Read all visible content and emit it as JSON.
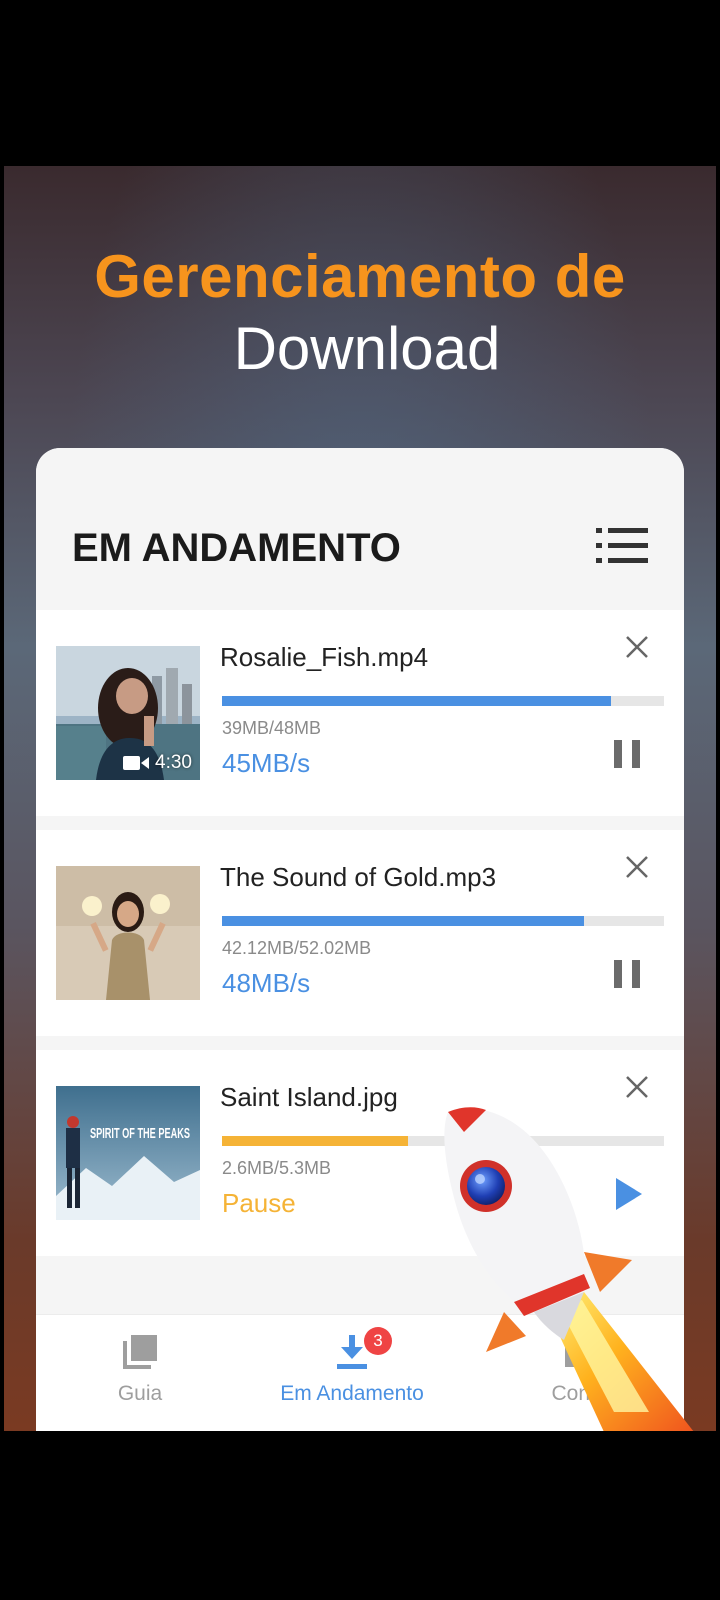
{
  "promo": {
    "headline": "Gerenciamento de",
    "subline": "Download"
  },
  "panel": {
    "title": "EM ANDAMENTO",
    "menu_icon": "list-icon"
  },
  "downloads": [
    {
      "filename": "Rosalie_Fish.mp4",
      "size": "39MB/48MB",
      "status": "45MB/s",
      "duration": "4:30",
      "progress": 0.88,
      "state": "downloading",
      "bar_color": "#4a90e2",
      "status_color": "#4a90e2"
    },
    {
      "filename": "The Sound of Gold.mp3",
      "size": "42.12MB/52.02MB",
      "status": "48MB/s",
      "progress": 0.82,
      "state": "downloading",
      "bar_color": "#4a90e2",
      "status_color": "#4a90e2"
    },
    {
      "filename": "Saint Island.jpg",
      "size": "2.6MB/5.3MB",
      "status": "Pause",
      "progress": 0.42,
      "state": "paused",
      "bar_color": "#f5b336",
      "status_color": "#f5b336",
      "thumb_text": "SPIRIT OF THE PEAKS"
    }
  ],
  "nav": {
    "guide_label": "Guia",
    "in_progress_label": "Em Andamento",
    "in_progress_badge": "3",
    "completed_label": "Conc",
    "active_color": "#4a90e2",
    "inactive_color": "#9e9e9e"
  }
}
